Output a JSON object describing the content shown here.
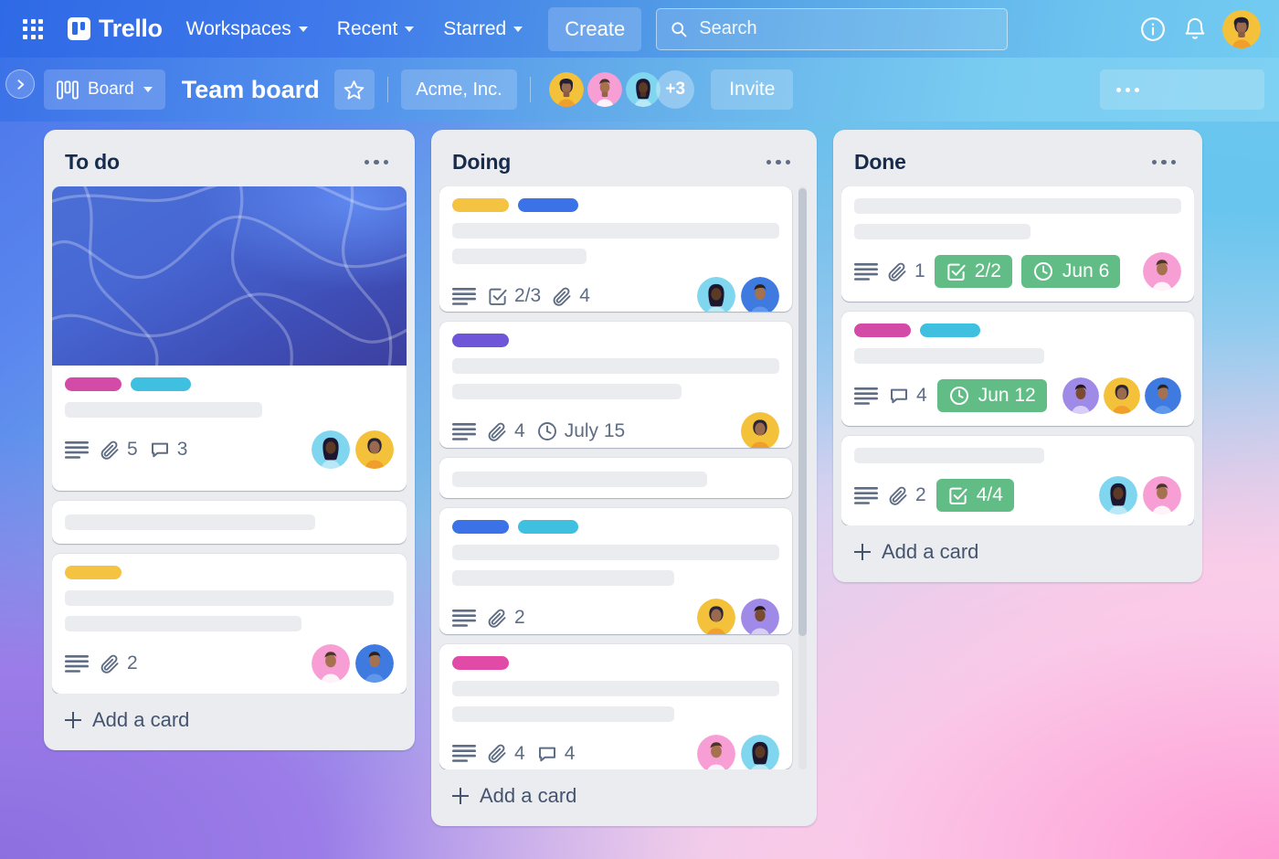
{
  "topnav": {
    "apps_icon": "apps-grid-icon",
    "brand": "Trello",
    "menus": [
      {
        "label": "Workspaces"
      },
      {
        "label": "Recent"
      },
      {
        "label": "Starred"
      }
    ],
    "create_label": "Create",
    "search": {
      "placeholder": "Search",
      "value": "",
      "icon": "search-icon"
    },
    "info_icon": "info-icon",
    "notifications_icon": "bell-icon",
    "account_icon": "user-avatar"
  },
  "boardbar": {
    "sidebar_toggle_icon": "chevron-right-icon",
    "view_label": "Board",
    "view_icon": "board-view-icon",
    "title": "Team board",
    "star_icon": "star-icon",
    "workspace": "Acme, Inc.",
    "members_overflow": "+3",
    "invite_label": "Invite",
    "more_icon": "more-horizontal-icon"
  },
  "colors": {
    "label_pink": "#d44ba7",
    "label_sky": "#3fc0e0",
    "label_yellow": "#f5c342",
    "label_blue": "#3b72e8",
    "label_purple": "#6f56d8",
    "label_magenta": "#e24aa8",
    "badge_green": "#61bd85",
    "list_bg": "#ebecf0",
    "text_subtle": "#5e6c84"
  },
  "lists": [
    {
      "title": "To do",
      "more_icon": "more-horizontal-icon",
      "add_card_label": "Add a card",
      "scroll": false,
      "cards": [
        {
          "cover": "blue-abstract-cover",
          "labels": [
            "#d44ba7",
            "#3fc0e0"
          ],
          "title_lines": [
            60
          ],
          "badges": [
            {
              "type": "description",
              "icon": "description-icon",
              "text": ""
            },
            {
              "type": "attachment",
              "icon": "paperclip-icon",
              "text": "5"
            },
            {
              "type": "comment",
              "icon": "comment-icon",
              "text": "3"
            }
          ],
          "avatars": [
            "teal",
            "yellow"
          ]
        },
        {
          "labels": [],
          "title_lines": [
            76
          ],
          "badges": [],
          "avatars": []
        },
        {
          "labels": [
            "#f5c342"
          ],
          "title_lines": [
            100,
            72
          ],
          "badges": [
            {
              "type": "description",
              "icon": "description-icon",
              "text": ""
            },
            {
              "type": "attachment",
              "icon": "paperclip-icon",
              "text": "2"
            }
          ],
          "avatars": [
            "pink",
            "blue"
          ]
        }
      ]
    },
    {
      "title": "Doing",
      "more_icon": "more-horizontal-icon",
      "add_card_label": "Add a card",
      "scroll": true,
      "cards": [
        {
          "labels": [
            "#f5c342",
            "#3b72e8"
          ],
          "title_lines": [
            100,
            41
          ],
          "badges": [
            {
              "type": "description",
              "icon": "description-icon",
              "text": ""
            },
            {
              "type": "checklist",
              "icon": "checkbox-icon",
              "text": "2/3"
            },
            {
              "type": "attachment",
              "icon": "paperclip-icon",
              "text": "4"
            }
          ],
          "avatars": [
            "teal",
            "blue"
          ]
        },
        {
          "labels": [
            "#6f56d8"
          ],
          "title_lines": [
            100,
            70
          ],
          "badges": [
            {
              "type": "description",
              "icon": "description-icon",
              "text": ""
            },
            {
              "type": "attachment",
              "icon": "paperclip-icon",
              "text": "4"
            },
            {
              "type": "due-date",
              "icon": "clock-icon",
              "text": "July 15"
            }
          ],
          "avatars": [
            "yellow"
          ]
        },
        {
          "labels": [],
          "title_lines": [
            78
          ],
          "badges": [],
          "avatars": []
        },
        {
          "labels": [
            "#3b72e8",
            "#3fc0e0"
          ],
          "title_lines": [
            100,
            68
          ],
          "badges": [
            {
              "type": "description",
              "icon": "description-icon",
              "text": ""
            },
            {
              "type": "attachment",
              "icon": "paperclip-icon",
              "text": "2"
            }
          ],
          "avatars": [
            "yellow",
            "purple"
          ]
        },
        {
          "labels": [
            "#e24aa8"
          ],
          "title_lines": [
            100,
            68
          ],
          "badges": [
            {
              "type": "description",
              "icon": "description-icon",
              "text": ""
            },
            {
              "type": "attachment",
              "icon": "paperclip-icon",
              "text": "4"
            },
            {
              "type": "comment",
              "icon": "comment-icon",
              "text": "4"
            }
          ],
          "avatars": [
            "pink",
            "teal"
          ]
        }
      ]
    },
    {
      "title": "Done",
      "more_icon": "more-horizontal-icon",
      "add_card_label": "Add a card",
      "scroll": false,
      "cards": [
        {
          "labels": [],
          "title_lines": [
            100,
            54
          ],
          "badges": [
            {
              "type": "description",
              "icon": "description-icon",
              "text": ""
            },
            {
              "type": "attachment",
              "icon": "paperclip-icon",
              "text": "1"
            },
            {
              "type": "checklist-complete",
              "icon": "checkbox-icon",
              "text": "2/2",
              "complete": true
            },
            {
              "type": "due-date-complete",
              "icon": "clock-icon",
              "text": "Jun 6",
              "complete": true
            }
          ],
          "avatars": [
            "pink"
          ]
        },
        {
          "labels": [
            "#d44ba7",
            "#3fc0e0"
          ],
          "title_lines": [
            58
          ],
          "badges": [
            {
              "type": "description",
              "icon": "description-icon",
              "text": ""
            },
            {
              "type": "comment",
              "icon": "comment-icon",
              "text": "4"
            },
            {
              "type": "due-date-complete",
              "icon": "clock-icon",
              "text": "Jun 12",
              "complete": true
            }
          ],
          "avatars": [
            "purple",
            "yellow",
            "blue"
          ]
        },
        {
          "labels": [],
          "title_lines": [
            58
          ],
          "badges": [
            {
              "type": "description",
              "icon": "description-icon",
              "text": ""
            },
            {
              "type": "attachment",
              "icon": "paperclip-icon",
              "text": "2"
            },
            {
              "type": "checklist-complete",
              "icon": "checkbox-icon",
              "text": "4/4",
              "complete": true
            }
          ],
          "avatars": [
            "teal",
            "pink"
          ]
        }
      ]
    }
  ]
}
